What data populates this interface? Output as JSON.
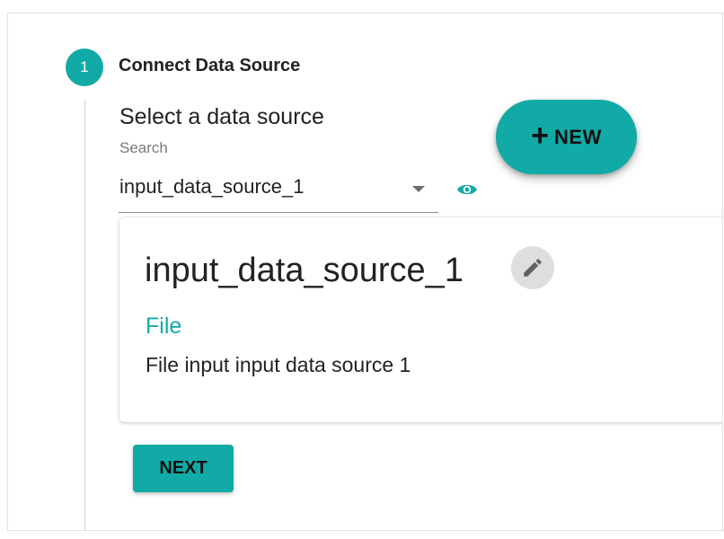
{
  "stepper": {
    "step_number": "1",
    "step_title": "Connect Data Source"
  },
  "data_source": {
    "heading": "Select a data source",
    "search_label": "Search",
    "selected_value": "input_data_source_1"
  },
  "new_button": {
    "label": "NEW",
    "icon": "plus-icon"
  },
  "card": {
    "title": "input_data_source_1",
    "type": "File",
    "description": "File input input data source 1",
    "edit_icon": "pencil-icon"
  },
  "next_button": {
    "label": "NEXT"
  },
  "colors": {
    "accent": "#12aaa6",
    "text": "#222222",
    "muted": "#7a7a7a"
  }
}
